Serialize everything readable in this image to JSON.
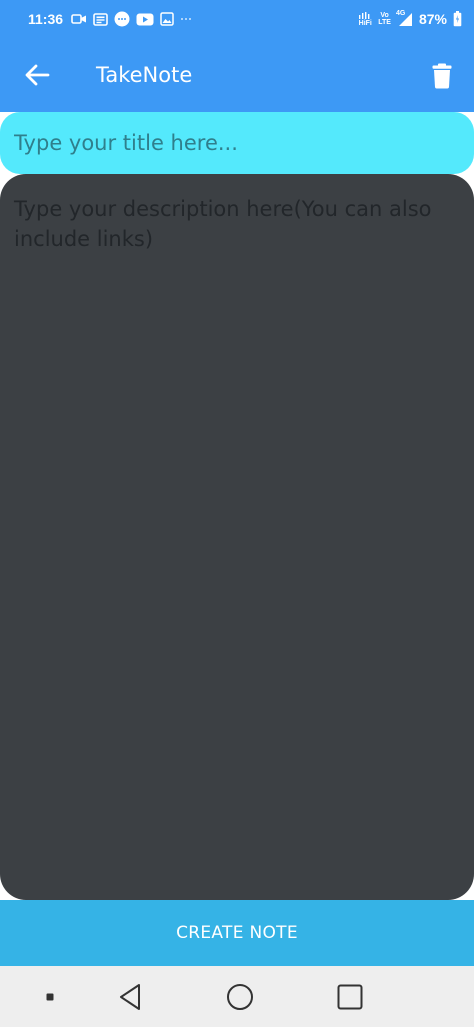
{
  "status_bar": {
    "time": "11:36",
    "notification_icons": [
      "video-call-icon",
      "news-icon",
      "messages-icon",
      "youtube-icon",
      "gallery-icon",
      "more-dots-icon"
    ],
    "hifi_label": "HiFi",
    "volte_top": "Vo",
    "volte_bottom": "LTE",
    "network_label": "4G",
    "battery_percent": "87%"
  },
  "app_bar": {
    "title": "TakeNote",
    "background": "#3d99f5"
  },
  "form": {
    "title_placeholder": "Type your title here...",
    "title_value": "",
    "description_placeholder": "Type your description here(You can also include links)",
    "description_value": ""
  },
  "actions": {
    "create_label": "CREATE NOTE"
  },
  "colors": {
    "title_bg": "#54e9fc",
    "description_bg": "#3c4044",
    "button_bg": "#35b3e6",
    "nav_bg": "#eeeeee"
  }
}
